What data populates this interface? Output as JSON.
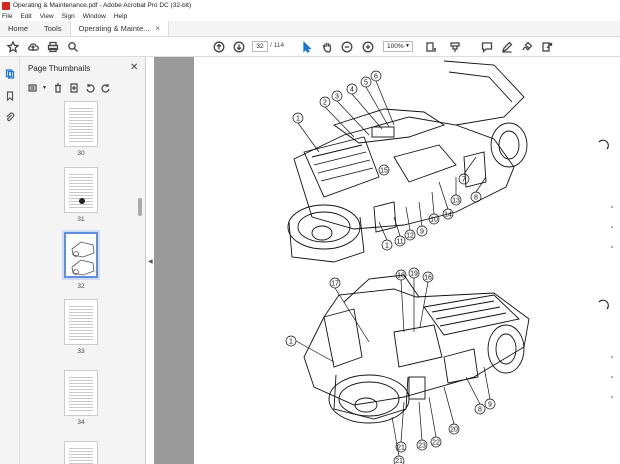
{
  "window": {
    "title": "Operating & Maintenance.pdf - Adobe Acrobat Pro DC (32-bit)"
  },
  "menu": [
    "File",
    "Edit",
    "View",
    "Sign",
    "Window",
    "Help"
  ],
  "tabs": {
    "home": "Home",
    "tools": "Tools",
    "document": "Operating & Mainte..."
  },
  "toolbar": {
    "current_page": "32",
    "page_total": "/ 114",
    "zoom": "100%"
  },
  "panel": {
    "title": "Page Thumbnails"
  },
  "thumbnails": [
    {
      "num": "30"
    },
    {
      "num": "31"
    },
    {
      "num": "32",
      "selected": true
    },
    {
      "num": "33"
    },
    {
      "num": "34"
    }
  ],
  "diagram_top_labels": [
    "1",
    "2",
    "3",
    "4",
    "5",
    "6",
    "7",
    "8",
    "9",
    "10",
    "11",
    "12",
    "13",
    "14",
    "15",
    "1"
  ],
  "diagram_bottom_labels": [
    "17",
    "18",
    "19",
    "16",
    "1",
    "8",
    "9",
    "20",
    "21",
    "22",
    "23",
    "21"
  ],
  "accent": "#1473e6"
}
